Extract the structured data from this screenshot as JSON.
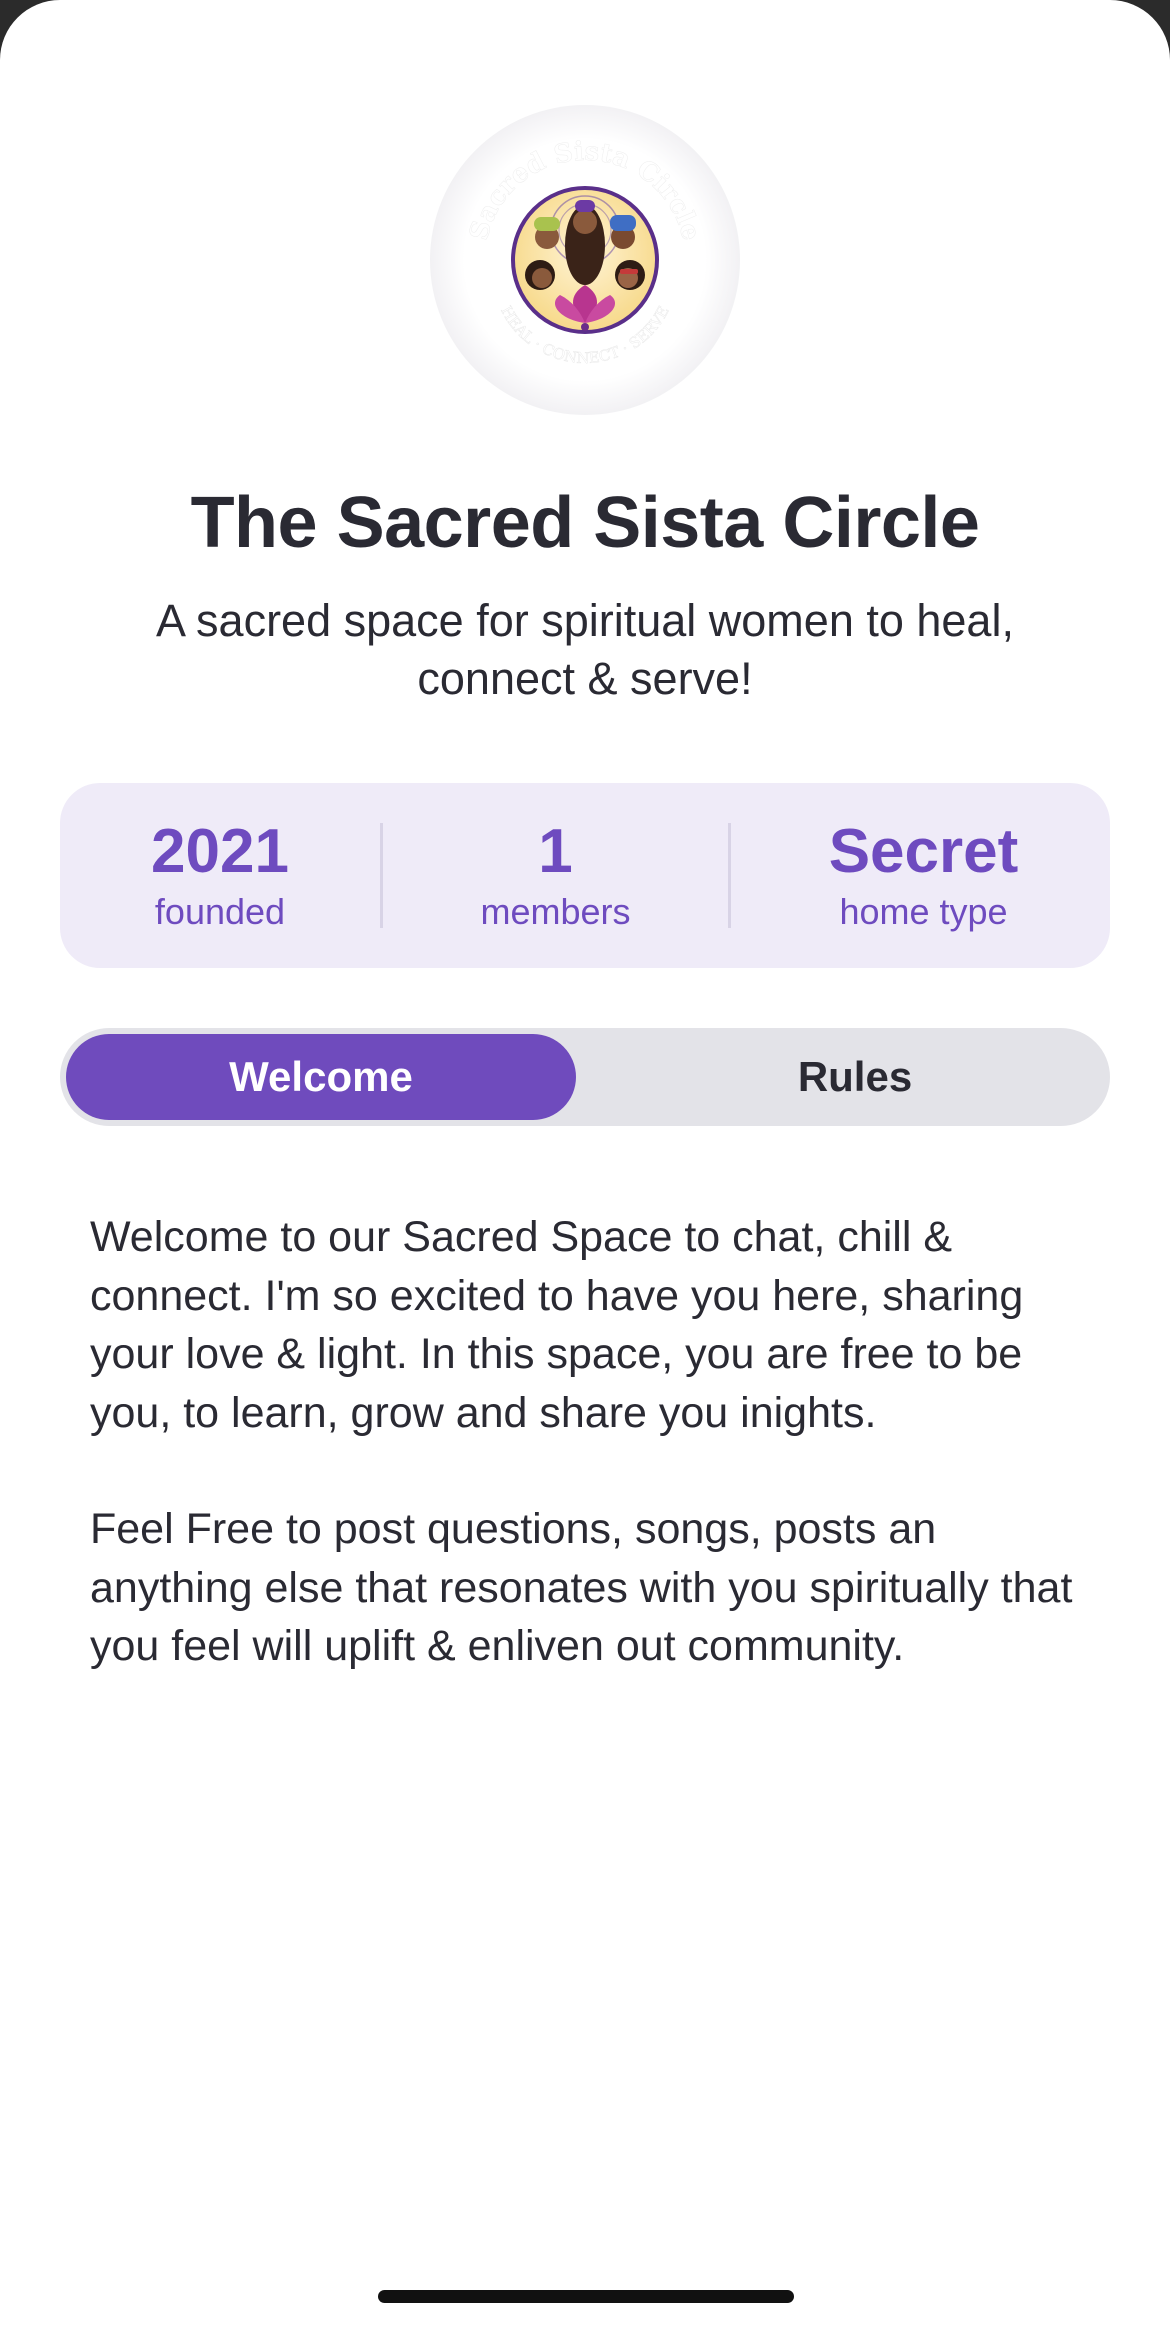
{
  "community": {
    "logo_icon": "sacred-sista-circle-logo",
    "logo_text_top": "Sacred Sista Circle",
    "logo_text_bottom": "HEAL · CONNECT · SERVE",
    "name": "The Sacred Sista Circle",
    "tagline": "A sacred space for spiritual women to heal, connect & serve!"
  },
  "stats": [
    {
      "value": "2021",
      "label": "founded"
    },
    {
      "value": "1",
      "label": "members"
    },
    {
      "value": "Secret",
      "label": "home type"
    }
  ],
  "tabs": [
    {
      "label": "Welcome",
      "active": true
    },
    {
      "label": "Rules",
      "active": false
    }
  ],
  "welcome": {
    "paragraphs": [
      "Welcome to our Sacred Space to chat, chill & connect. I'm so excited to have you here, sharing your love & light. In this space, you are free to be you, to learn, grow and share you inights.",
      "Feel Free to post questions, songs, posts an anything else that resonates with you spiritually that you feel will uplift & enliven out community."
    ]
  },
  "colors": {
    "accent": "#6f4bbd",
    "stats_background": "#efebf8",
    "tab_track": "#e3e3e8",
    "text": "#2a2a33"
  }
}
